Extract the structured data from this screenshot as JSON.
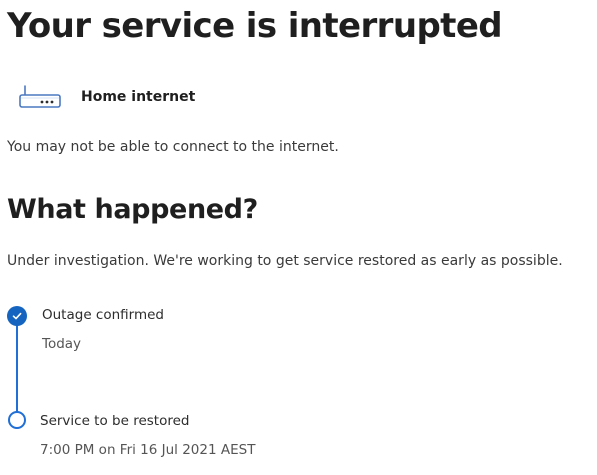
{
  "page": {
    "title": "Your service is interrupted"
  },
  "service": {
    "icon": "modem-icon",
    "name": "Home internet",
    "impact": "You may not be able to connect to the internet."
  },
  "what_happened": {
    "heading": "What happened?",
    "description": "Under investigation. We're working to get service restored as early as possible."
  },
  "timeline": {
    "accent_color": "#1565c0",
    "steps": [
      {
        "label": "Outage confirmed",
        "detail": "Today",
        "status": "completed",
        "icon": "check-circle-icon"
      },
      {
        "label": "Service to be restored",
        "detail": "7:00 PM on Fri 16 Jul 2021 AEST",
        "status": "pending",
        "icon": "empty-circle-icon"
      }
    ]
  }
}
